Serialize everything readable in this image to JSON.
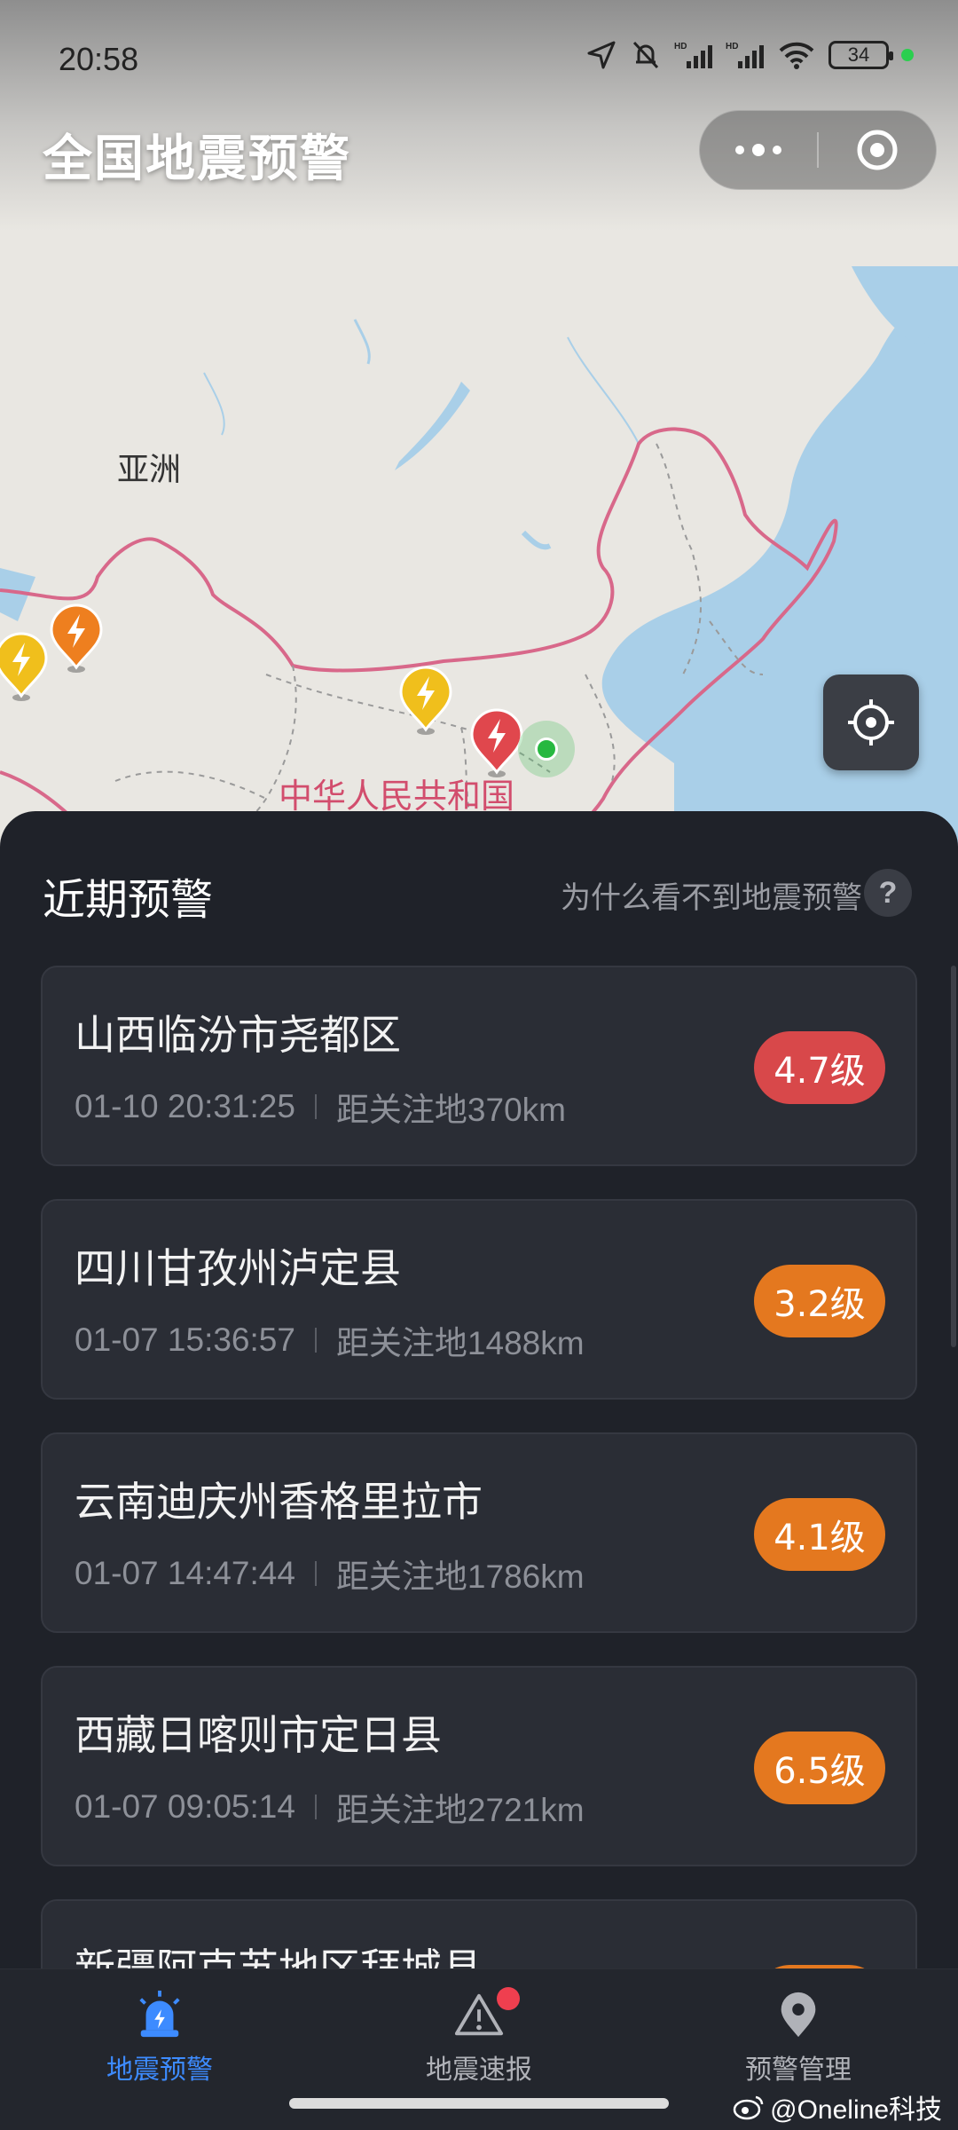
{
  "status_bar": {
    "time": "20:58",
    "battery": "34",
    "signal_label_1": "HD",
    "signal_label_2": "HD",
    "icons": [
      "location-arrow-icon",
      "bell-off-icon",
      "signal-icon",
      "signal-icon",
      "wifi-icon",
      "battery-icon"
    ]
  },
  "header": {
    "title": "全国地震预警"
  },
  "map": {
    "labels": {
      "asia": "亚洲",
      "china": "中华人民共和国"
    },
    "pins": [
      {
        "color": "#f0bf1c",
        "kind": "warning"
      },
      {
        "color": "#ee7f1f",
        "kind": "warning"
      },
      {
        "color": "#f0bf1c",
        "kind": "warning"
      },
      {
        "color": "#e0474d",
        "kind": "warning"
      }
    ]
  },
  "sheet": {
    "title": "近期预警",
    "why_link": "为什么看不到地震预警",
    "help_glyph": "?",
    "items": [
      {
        "place": "山西临汾市尧都区",
        "time": "01-10 20:31:25",
        "distance": "距关注地370km",
        "magnitude": "4.7级",
        "color": "#d8484a"
      },
      {
        "place": "四川甘孜州泸定县",
        "time": "01-07 15:36:57",
        "distance": "距关注地1488km",
        "magnitude": "3.2级",
        "color": "#e4781f"
      },
      {
        "place": "云南迪庆州香格里拉市",
        "time": "01-07 14:47:44",
        "distance": "距关注地1786km",
        "magnitude": "4.1级",
        "color": "#e4781f"
      },
      {
        "place": "西藏日喀则市定日县",
        "time": "01-07 09:05:14",
        "distance": "距关注地2721km",
        "magnitude": "6.5级",
        "color": "#e4781f"
      },
      {
        "place": "新疆阿克苏地区拜城县",
        "time": "",
        "distance": "",
        "magnitude": "",
        "color": "#e4781f"
      }
    ]
  },
  "tabs": [
    {
      "label": "地震预警",
      "icon": "siren-icon",
      "active": true
    },
    {
      "label": "地震速报",
      "icon": "warning-triangle-icon",
      "active": false
    },
    {
      "label": "预警管理",
      "icon": "map-pin-icon",
      "active": false
    }
  ],
  "colors": {
    "accent": "#3d8bff",
    "sheet_bg": "#1f2229",
    "card_bg": "#2a2d35"
  },
  "watermark": "@Oneline科技"
}
